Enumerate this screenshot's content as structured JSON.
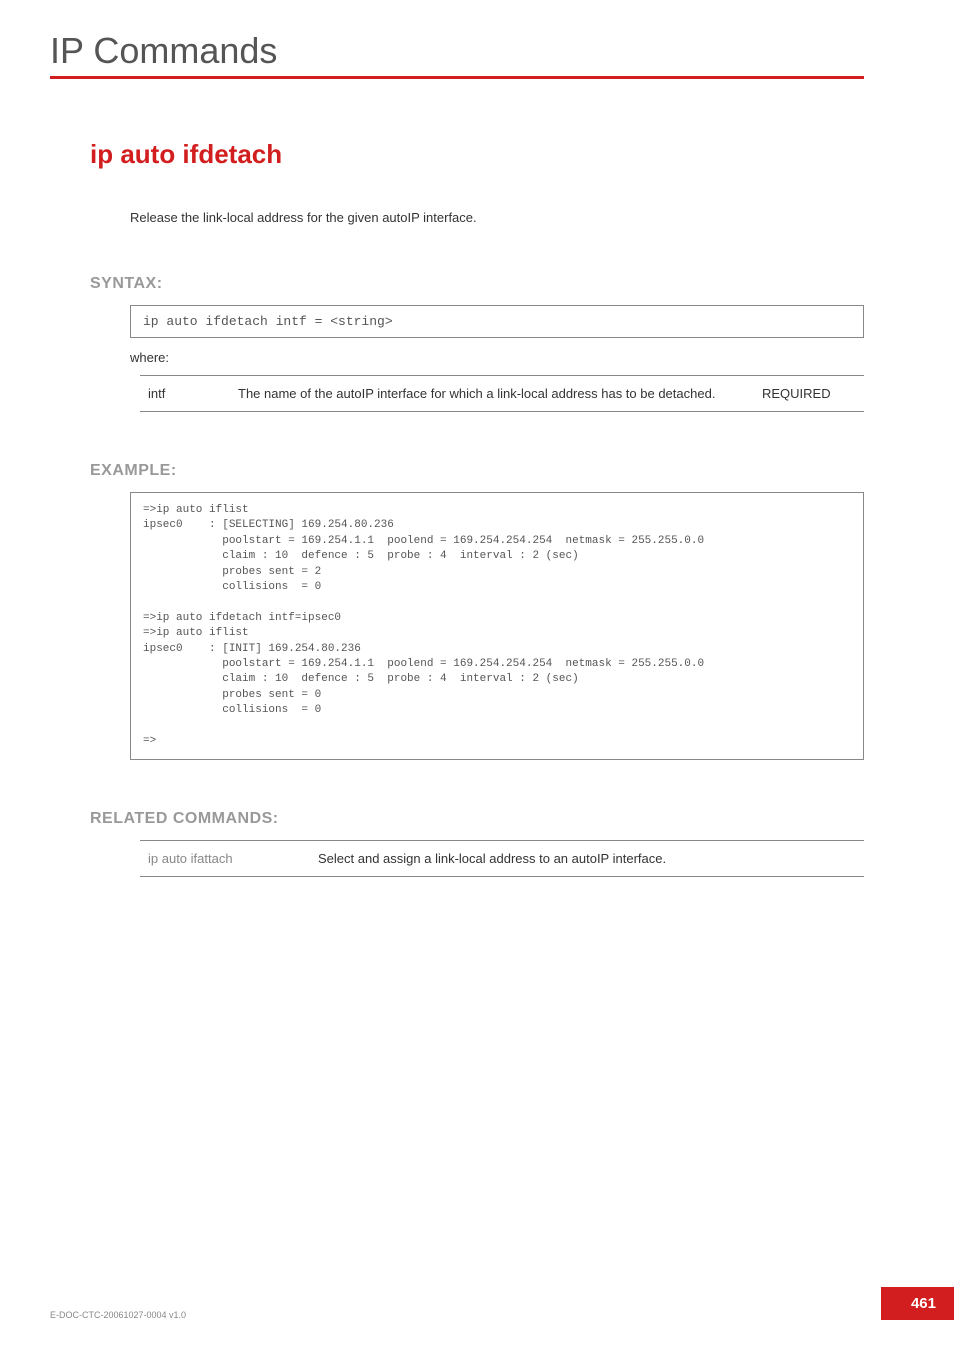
{
  "header": {
    "section_title": "IP Commands"
  },
  "command": {
    "name": "ip auto ifdetach",
    "description": "Release the link-local address for the given autoIP interface."
  },
  "syntax": {
    "label": "SYNTAX:",
    "code": "ip auto ifdetach     intf = <string>",
    "where": "where:",
    "params": [
      {
        "name": "intf",
        "desc": "The name of the autoIP interface for which a link-local address has to be detached.",
        "req": "REQUIRED"
      }
    ]
  },
  "example": {
    "label": "EXAMPLE:",
    "code": "=>ip auto iflist\nipsec0    : [SELECTING] 169.254.80.236\n            poolstart = 169.254.1.1  poolend = 169.254.254.254  netmask = 255.255.0.0\n            claim : 10  defence : 5  probe : 4  interval : 2 (sec)\n            probes sent = 2\n            collisions  = 0\n\n=>ip auto ifdetach intf=ipsec0\n=>ip auto iflist\nipsec0    : [INIT] 169.254.80.236\n            poolstart = 169.254.1.1  poolend = 169.254.254.254  netmask = 255.255.0.0\n            claim : 10  defence : 5  probe : 4  interval : 2 (sec)\n            probes sent = 0\n            collisions  = 0\n\n=>"
  },
  "related": {
    "label": "RELATED COMMANDS:",
    "items": [
      {
        "cmd": "ip auto ifattach",
        "desc": "Select and assign a link-local address to an autoIP interface."
      }
    ]
  },
  "footer": {
    "doc_id": "E-DOC-CTC-20061027-0004 v1.0",
    "page": "461"
  }
}
